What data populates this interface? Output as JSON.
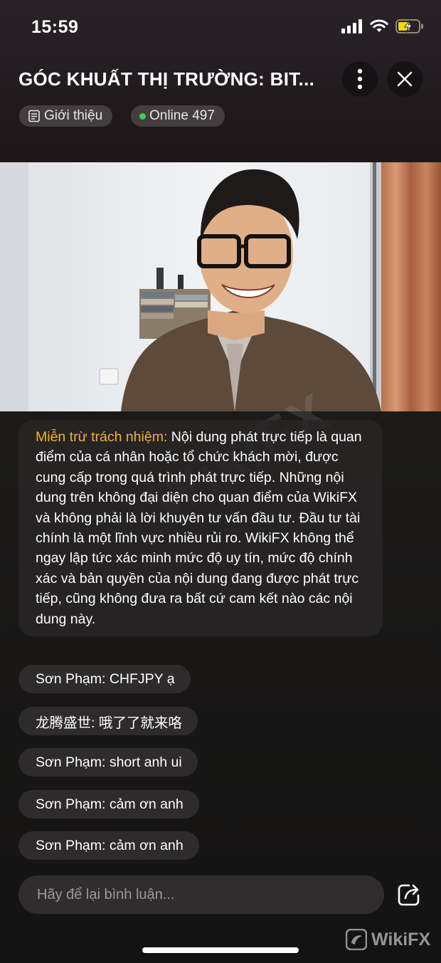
{
  "status_bar": {
    "time": "15:59"
  },
  "header": {
    "title": "GÓC KHUẤT THỊ TRƯỜNG: BIT...",
    "intro_label": "Giới thiệu",
    "online_label": "Online 497"
  },
  "disclaimer": {
    "label": "Miễn trừ trách nhiệm:",
    "text": " Nội dung phát trực tiếp là quan điểm của cá nhân hoặc tổ chức khách mời, được cung cấp trong quá trình phát trực tiếp. Những nội dung trên không đại diện cho quan điểm của WikiFX và không phải là lời khuyên tư vấn đầu tư. Đầu tư tài chính là một lĩnh vực nhiều rủi ro. WikiFX không thể ngay lập tức xác minh mức độ uy tín, mức độ chính xác và bản quyền của nội dung đang được phát trực tiếp, cũng không đưa ra bất cứ cam kết nào các nội dung này."
  },
  "messages": [
    {
      "text": "Sơn Phạm: CHFJPY ạ"
    },
    {
      "text": "龙腾盛世: 哦了了就来咯"
    },
    {
      "text": "Sơn Phạm: short anh ui"
    },
    {
      "text": "Sơn Phạm: cảm ơn anh"
    },
    {
      "text": "Sơn Phạm: cảm ơn anh"
    }
  ],
  "comment": {
    "placeholder": "Hãy để lại bình luận..."
  },
  "watermark": {
    "brand": "WikiFX",
    "diag": "WikiFX"
  },
  "icons": {
    "signal": "signal-icon",
    "wifi": "wifi-icon",
    "battery": "battery-charging-icon",
    "more": "more-vertical-icon",
    "close": "close-icon",
    "intro": "document-icon",
    "share": "share-icon"
  },
  "colors": {
    "accent_label": "#f2b13c",
    "online_dot": "#39d353"
  }
}
